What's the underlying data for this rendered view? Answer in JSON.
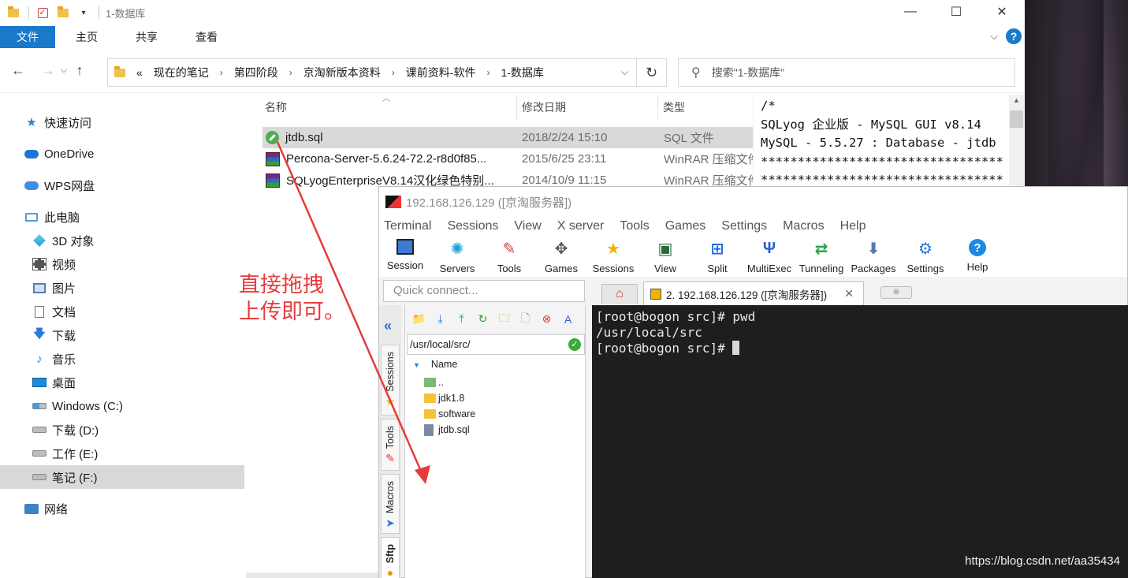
{
  "explorer": {
    "title": "1-数据库",
    "window_controls": {
      "minimize": "—",
      "maximize": "☐",
      "close": "✕"
    },
    "ribbon": {
      "file": "文件",
      "tabs": [
        "主页",
        "共享",
        "查看"
      ],
      "help": "?"
    },
    "address": {
      "prefix": "«",
      "crumbs": [
        "现在的笔记",
        "第四阶段",
        "京淘新版本资料",
        "课前资料-软件",
        "1-数据库"
      ]
    },
    "search_placeholder": "搜索\"1-数据库\"",
    "nav": {
      "quick_access": "快速访问",
      "onedrive": "OneDrive",
      "wps": "WPS网盘",
      "this_pc": "此电脑",
      "items": [
        "3D 对象",
        "视频",
        "图片",
        "文档",
        "下载",
        "音乐",
        "桌面",
        "Windows (C:)",
        "下载 (D:)",
        "工作 (E:)",
        "笔记 (F:)"
      ],
      "network": "网络"
    },
    "columns": {
      "name": "名称",
      "date": "修改日期",
      "type": "类型"
    },
    "files": [
      {
        "name": "jtdb.sql",
        "date": "2018/2/24 15:10",
        "type": "SQL 文件"
      },
      {
        "name": "Percona-Server-5.6.24-72.2-r8d0f85...",
        "date": "2015/6/25 23:11",
        "type": "WinRAR 压缩文件"
      },
      {
        "name": "SQLyogEnterpriseV8.14汉化绿色特别...",
        "date": "2014/10/9 11:15",
        "type": "WinRAR 压缩文件"
      }
    ],
    "preview_lines": [
      "/*",
      "SQLyog 企业版 - MySQL GUI v8.14",
      "MySQL - 5.5.27 : Database - jtdb",
      "*********************************",
      "*********************************"
    ]
  },
  "moba": {
    "title": "192.168.126.129 ([京淘服务器])",
    "menu": [
      "Terminal",
      "Sessions",
      "View",
      "X server",
      "Tools",
      "Games",
      "Settings",
      "Macros",
      "Help"
    ],
    "toolbar": [
      "Session",
      "Servers",
      "Tools",
      "Games",
      "Sessions",
      "View",
      "Split",
      "MultiExec",
      "Tunneling",
      "Packages",
      "Settings",
      "Help"
    ],
    "quick_connect_placeholder": "Quick connect...",
    "tab_label": "2.  192.168.126.129  ([京淘服务器])",
    "side_tabs": {
      "sessions": "Sessions",
      "tools": "Tools",
      "macros": "Macros",
      "sftp": "Sftp"
    },
    "sftp_path": "/usr/local/src/",
    "sftp_header": "Name",
    "sftp_items": [
      "..",
      "jdk1.8",
      "software",
      "jtdb.sql"
    ],
    "terminal_lines": [
      "[root@bogon src]# pwd",
      "/usr/local/src",
      "[root@bogon src]# "
    ]
  },
  "annotation": {
    "line1": "直接拖拽",
    "line2": "上传即可。"
  },
  "watermark": "https://blog.csdn.net/aa35434",
  "colors": {
    "accent": "#1979ca",
    "annotation": "#e53c3c",
    "terminal_bg": "#1e1e1e"
  }
}
